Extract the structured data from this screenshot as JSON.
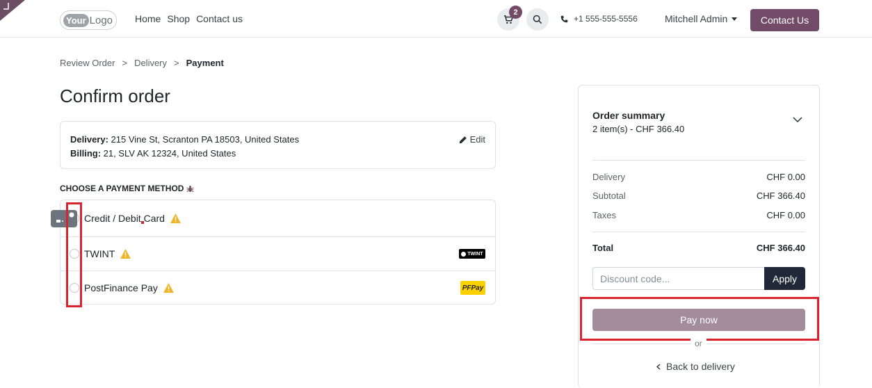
{
  "header": {
    "logo_your": "Your",
    "logo_logo": "Logo",
    "nav": [
      "Home",
      "Shop",
      "Contact us"
    ],
    "cart_count": "2",
    "phone": "+1 555-555-5556",
    "user_name": "Mitchell Admin",
    "contact_button": "Contact Us",
    "brand_color": "#714b67"
  },
  "breadcrumb": {
    "step1": "Review Order",
    "step2": "Delivery",
    "step3": "Payment",
    "separator": ">"
  },
  "page_title": "Confirm order",
  "address": {
    "delivery_label": "Delivery:",
    "delivery_value": "215 Vine St, Scranton PA 18503, United States",
    "billing_label": "Billing:",
    "billing_value": "21, SLV AK 12324, United States",
    "edit_label": "Edit"
  },
  "payment": {
    "heading": "CHOOSE A PAYMENT METHOD",
    "methods": [
      {
        "label": "Credit / Debit Card",
        "logo": "card-icon"
      },
      {
        "label": "TWINT",
        "logo": "TWINT"
      },
      {
        "label": "PostFinance Pay",
        "logo": "PFPay"
      }
    ]
  },
  "summary": {
    "title": "Order summary",
    "items_text": "2 item(s) -  CHF 366.40",
    "rows": [
      {
        "label": "Delivery",
        "value": "CHF 0.00"
      },
      {
        "label": "Subtotal",
        "value": "CHF 366.40"
      },
      {
        "label": "Taxes",
        "value": "CHF 0.00"
      }
    ],
    "total_label": "Total",
    "total_value": "CHF 366.40",
    "discount_placeholder": "Discount code...",
    "apply_label": "Apply",
    "pay_label": "Pay now",
    "or_label": "or",
    "back_label": "Back to delivery"
  },
  "highlight_color": "#d9232e"
}
